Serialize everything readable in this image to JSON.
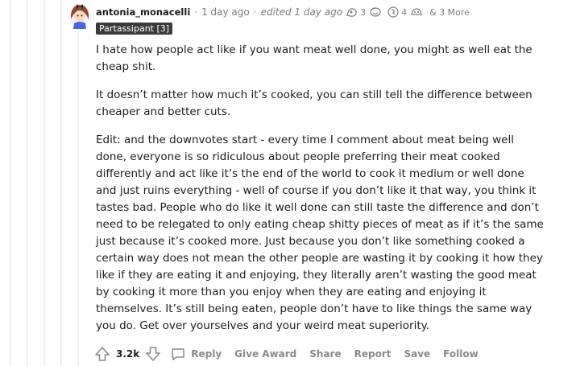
{
  "comment": {
    "username": "antonia_monacelli",
    "time": "1 day ago",
    "edited": "edited 1 day ago",
    "awards": [
      {
        "icon": "award-icon-1",
        "count": "3"
      },
      {
        "icon": "award-icon-2",
        "count": ""
      },
      {
        "icon": "award-icon-3",
        "count": "4"
      },
      {
        "icon": "award-icon-4",
        "count": ""
      }
    ],
    "more_awards": "& 3 More",
    "flair": "Partassipant [3]",
    "paragraphs": [
      "I hate how people act like if you want meat well done, you might as well eat the cheap shit.",
      "It doesn’t matter how much it’s cooked, you can still tell the difference between cheaper and better cuts.",
      "Edit: and the downvotes start - every time I comment about meat being well done, everyone is so ridiculous about people preferring their meat cooked differently and act like it’s the end of the world to cook it medium or well done and just ruins everything - well of course if you don’t like it that way, you think it tastes bad. People who do like it well done can still taste the difference and don’t need to be relegated to only eating cheap shitty pieces of meat as if it’s the same just because it’s cooked more. Just because you don’t like something cooked a certain way does not mean the other people are wasting it by cooking it how they like if they are eating it and enjoying, they literally aren’t wasting the good meat by cooking it more than you enjoy when they are eating and enjoying it themselves. It’s still being eaten, people don’t have to like things the same way you do. Get over yourselves and your weird meat superiority."
    ],
    "score": "3.2k",
    "actions": {
      "reply": "Reply",
      "give_award": "Give Award",
      "share": "Share",
      "report": "Report",
      "save": "Save",
      "follow": "Follow"
    }
  },
  "colors": {
    "thread_line": "#edeff1",
    "flair_bg": "#3b3b3b",
    "muted_text": "#878a8c"
  }
}
